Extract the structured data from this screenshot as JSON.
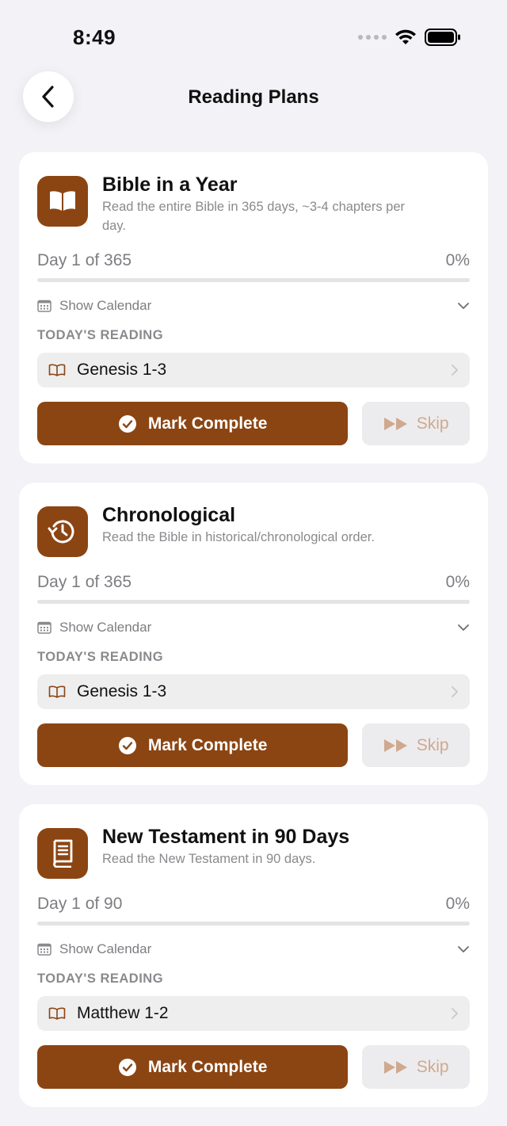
{
  "status_bar": {
    "time": "8:49"
  },
  "nav": {
    "title": "Reading Plans"
  },
  "labels": {
    "show_calendar": "Show Calendar",
    "todays_reading": "TODAY'S READING",
    "mark_complete": "Mark Complete",
    "skip": "Skip"
  },
  "colors": {
    "accent": "#8b4513",
    "background": "#f2f2f7",
    "card": "#ffffff"
  },
  "plans": [
    {
      "icon": "open-book-icon",
      "title": "Bible in a Year",
      "description": "Read the entire Bible in 365 days, ~3-4 chapters per day.",
      "day_text": "Day 1 of 365",
      "percent_text": "0%",
      "progress": 0,
      "reading": "Genesis 1-3"
    },
    {
      "icon": "history-clock-icon",
      "title": "Chronological",
      "description": "Read the Bible in historical/chronological order.",
      "day_text": "Day 1 of 365",
      "percent_text": "0%",
      "progress": 0,
      "reading": "Genesis 1-3"
    },
    {
      "icon": "closed-book-icon",
      "title": "New Testament in 90 Days",
      "description": "Read the New Testament in 90 days.",
      "day_text": "Day 1 of 90",
      "percent_text": "0%",
      "progress": 0,
      "reading": "Matthew 1-2"
    }
  ]
}
